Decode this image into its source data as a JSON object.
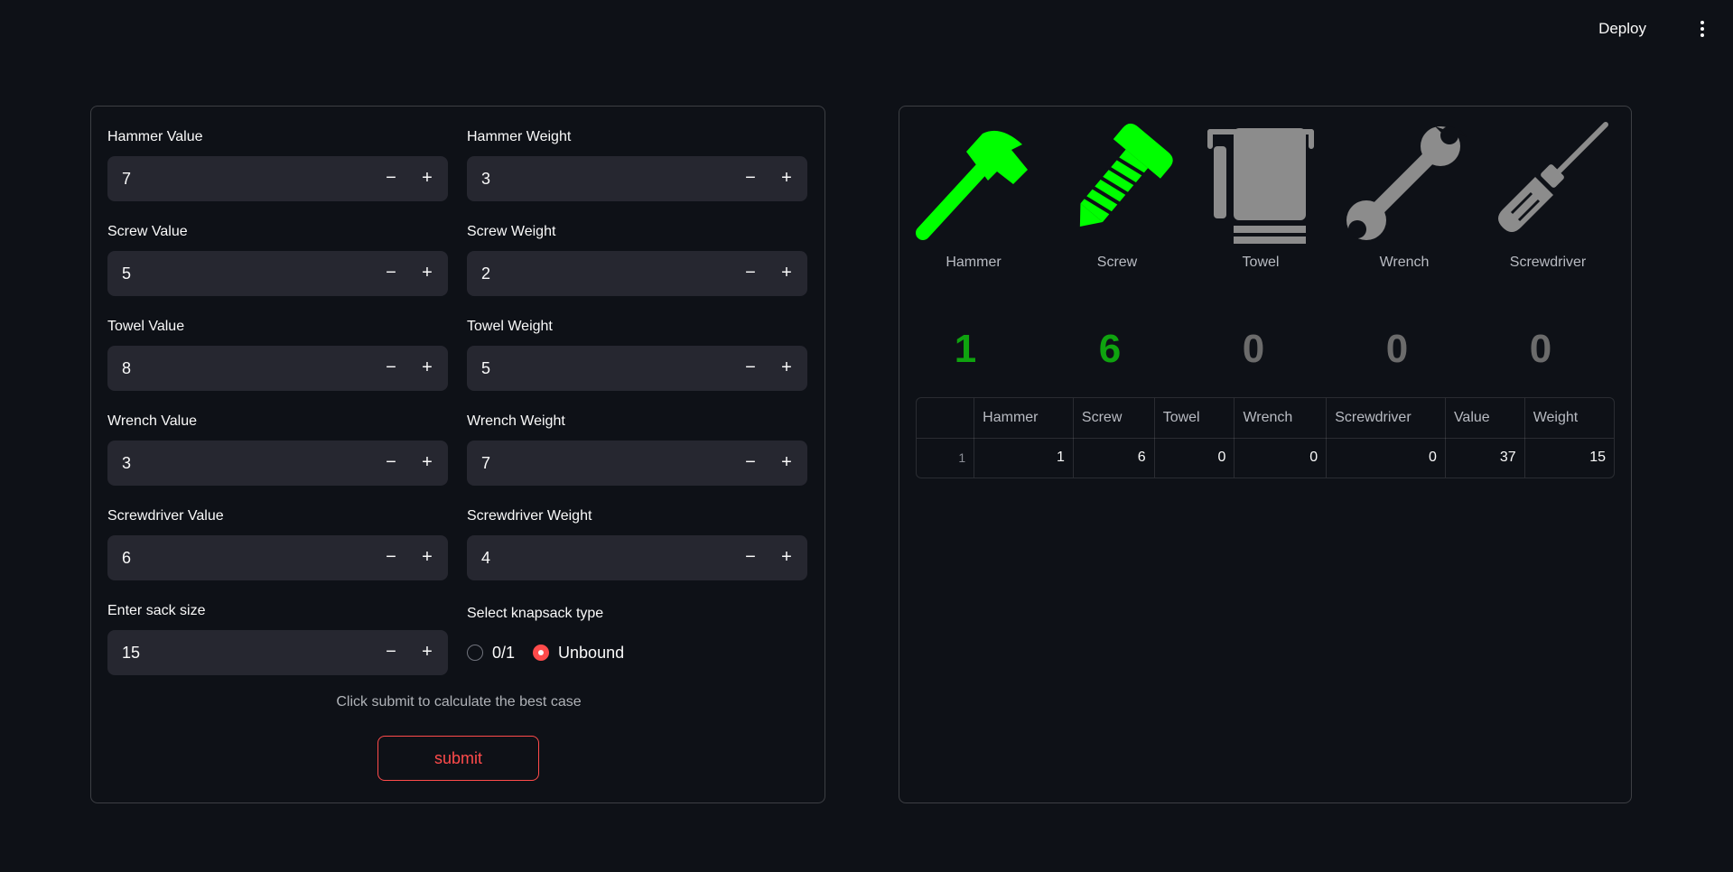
{
  "header": {
    "deploy_label": "Deploy",
    "menu_icon": "kebab-menu-icon"
  },
  "form": {
    "fields": [
      {
        "label": "Hammer Value",
        "value": "7"
      },
      {
        "label": "Hammer Weight",
        "value": "3"
      },
      {
        "label": "Screw Value",
        "value": "5"
      },
      {
        "label": "Screw Weight",
        "value": "2"
      },
      {
        "label": "Towel Value",
        "value": "8"
      },
      {
        "label": "Towel Weight",
        "value": "5"
      },
      {
        "label": "Wrench Value",
        "value": "3"
      },
      {
        "label": "Wrench Weight",
        "value": "7"
      },
      {
        "label": "Screwdriver Value",
        "value": "6"
      },
      {
        "label": "Screwdriver Weight",
        "value": "4"
      },
      {
        "label": "Enter sack size",
        "value": "15"
      }
    ],
    "stepper": {
      "minus": "−",
      "plus": "+"
    },
    "knapsack": {
      "label": "Select knapsack type",
      "options": [
        "0/1",
        "Unbound"
      ],
      "selected": "Unbound"
    },
    "hint": "Click submit to calculate the best case",
    "submit_label": "submit"
  },
  "results": {
    "items": [
      {
        "name": "Hammer",
        "count": "1",
        "icon": "hammer-icon",
        "active": true
      },
      {
        "name": "Screw",
        "count": "6",
        "icon": "screw-icon",
        "active": true
      },
      {
        "name": "Towel",
        "count": "0",
        "icon": "towel-icon",
        "active": false
      },
      {
        "name": "Wrench",
        "count": "0",
        "icon": "wrench-icon",
        "active": false
      },
      {
        "name": "Screwdriver",
        "count": "0",
        "icon": "screwdriver-icon",
        "active": false
      }
    ],
    "colors": {
      "active": "#00ff00",
      "inactive": "#8c8c8c",
      "count_active": "#0fa30f",
      "count_inactive": "#6b6b6b"
    },
    "table": {
      "headers": [
        "",
        "Hammer",
        "Screw",
        "Towel",
        "Wrench",
        "Screwdriver",
        "Value",
        "Weight"
      ],
      "rows": [
        [
          "1",
          "1",
          "6",
          "0",
          "0",
          "0",
          "37",
          "15"
        ]
      ]
    }
  }
}
